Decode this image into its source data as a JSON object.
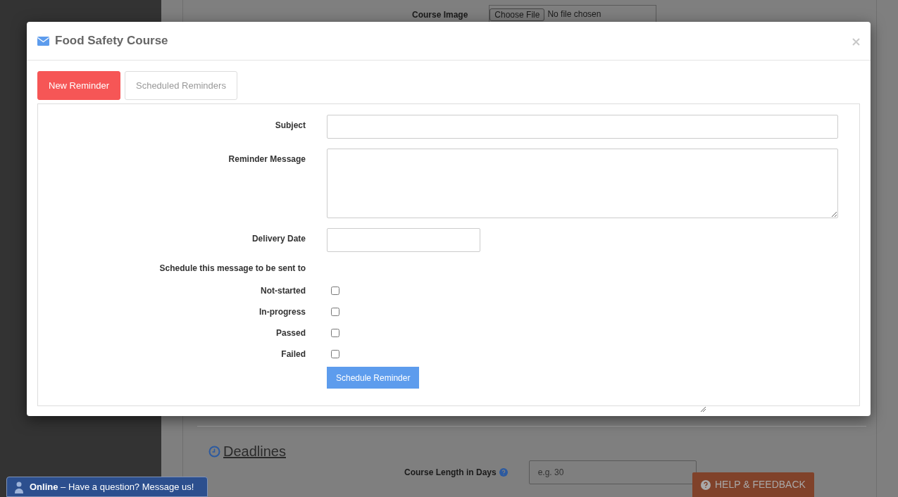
{
  "background": {
    "course_image_label": "Course Image",
    "file_button": "Choose File",
    "file_status": "No file chosen",
    "section_title": "Deadlines",
    "course_length_label": "Course Length in Days",
    "course_length_placeholder": "e.g. 30"
  },
  "modal": {
    "title": "Food Safety Course",
    "tabs": [
      {
        "label": "New Reminder",
        "selected": true
      },
      {
        "label": "Scheduled Reminders",
        "selected": false
      }
    ],
    "fields": [
      {
        "kind": "input",
        "label": "Subject"
      },
      {
        "kind": "textarea",
        "label": "Reminder Message"
      },
      {
        "kind": "date",
        "label": "Delivery Date"
      }
    ],
    "recipients_heading": "Schedule this message to be sent to",
    "recipients": [
      {
        "label": "Not-started",
        "checked": false
      },
      {
        "label": "In-progress",
        "checked": false
      },
      {
        "label": "Passed",
        "checked": false
      },
      {
        "label": "Failed",
        "checked": false
      }
    ],
    "submit": "Schedule Reminder"
  },
  "chat": {
    "message": "**Online** – Have a question? Message us!"
  },
  "help_button": "HELP & FEEDBACK"
}
